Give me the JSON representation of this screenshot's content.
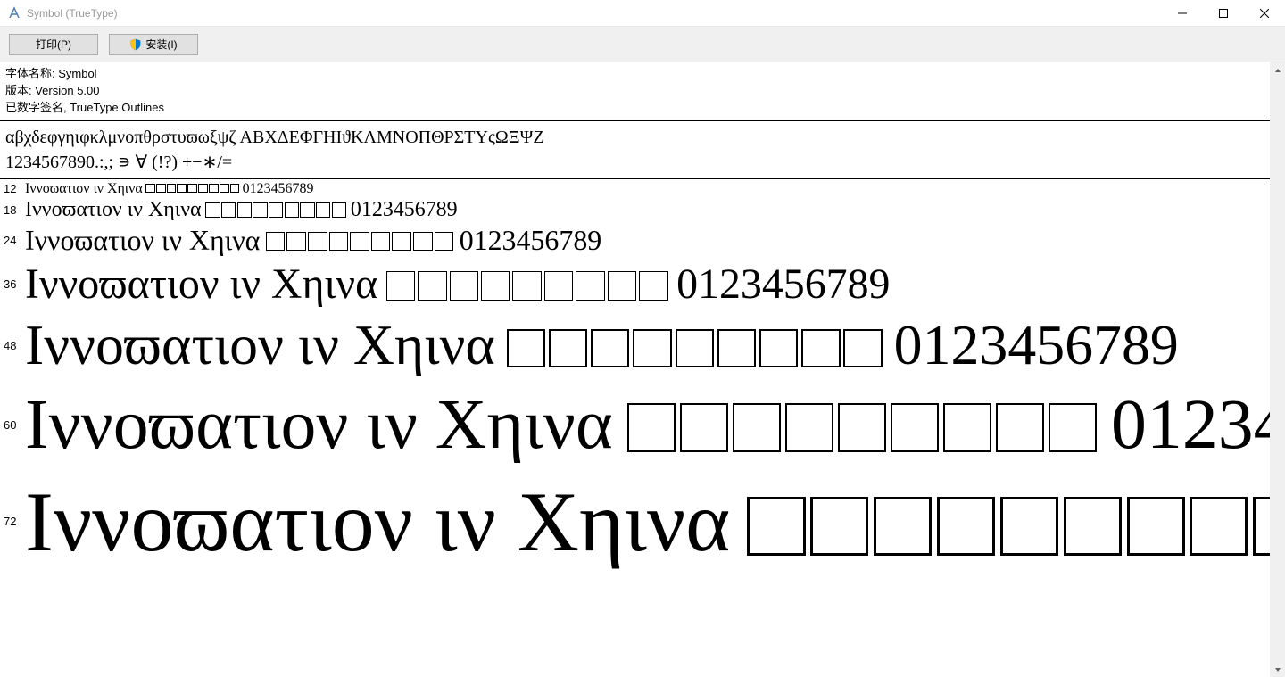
{
  "window": {
    "title": "Symbol (TrueType)"
  },
  "toolbar": {
    "print_label": "打印(P)",
    "install_label": "安装(I)"
  },
  "meta": {
    "name_line": "字体名称: Symbol",
    "version_line": "版本: Version 5.00",
    "sign_line": "已数字签名, TrueType Outlines"
  },
  "charset": {
    "line1": "αβχδεφγηιφκλμνοπθρστυϖωξψζ ΑΒΧΔΕΦΓΗΙϑΚΛΜΝΟΠΘΡΣΤΥςΩΞΨΖ",
    "line2": "1234567890.:,; ∍ ∀ (!?) +−∗/="
  },
  "sample": {
    "text_part1": "Ιννοϖατιον ιν Χηινα ",
    "numbers": " 0123456789",
    "box_count": 9,
    "sizes": [
      12,
      18,
      24,
      36,
      48,
      60,
      72
    ]
  }
}
